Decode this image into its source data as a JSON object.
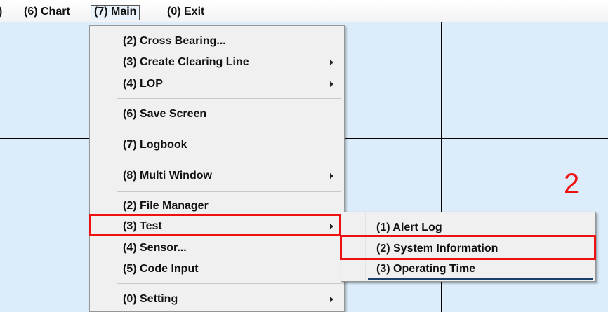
{
  "menubar": {
    "partial_left": ")",
    "chart": "(6) Chart",
    "main": "(7) Main",
    "exit": "(0) Exit"
  },
  "main_menu": {
    "items": [
      {
        "label": "(2) Cross Bearing...",
        "submenu": false
      },
      {
        "label": "(3) Create Clearing Line",
        "submenu": true
      },
      {
        "label": "(4) LOP",
        "submenu": true
      },
      {
        "label": "(6) Save Screen",
        "submenu": false
      },
      {
        "label": "(7) Logbook",
        "submenu": false
      },
      {
        "label": "(8) Multi Window",
        "submenu": true
      },
      {
        "label": "(2) File Manager",
        "submenu": false
      },
      {
        "label": "(3) Test",
        "submenu": true,
        "highlighted": true
      },
      {
        "label": "(4) Sensor...",
        "submenu": false
      },
      {
        "label": "(5) Code Input",
        "submenu": false
      },
      {
        "label": "(0) Setting",
        "submenu": true
      }
    ]
  },
  "test_submenu": {
    "items": [
      {
        "label": "(1) Alert Log"
      },
      {
        "label": "(2) System Information",
        "highlighted": true
      },
      {
        "label": "(3) Operating Time"
      }
    ]
  },
  "annotation": {
    "step_number": "2",
    "highlight_color": "#e11111"
  }
}
